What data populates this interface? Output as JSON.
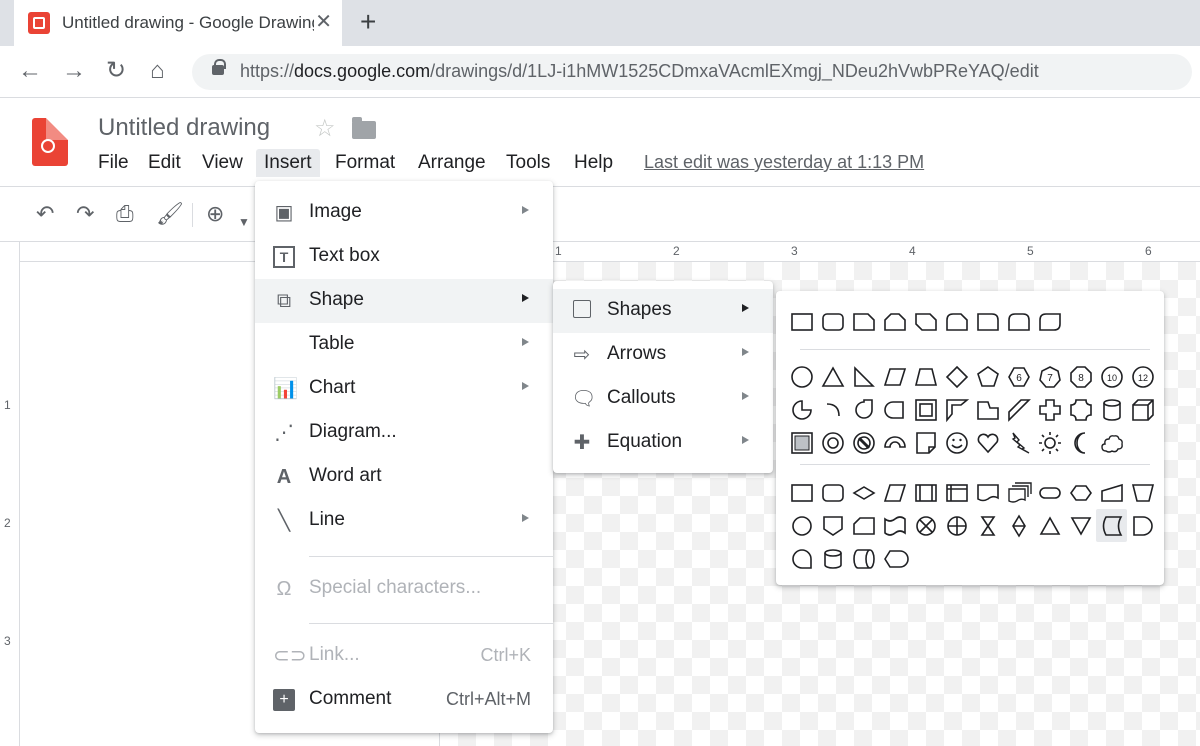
{
  "browser": {
    "tab_title": "Untitled drawing - Google Drawings",
    "tab_close": "✕",
    "new_tab": "+",
    "url_prefix": "https://",
    "url_domain": "docs.google.com",
    "url_path": "/drawings/d/1LJ-i1hMW1525CDmxaVAcmlEXmgj_NDeu2hVwbPReYAQ/edit"
  },
  "app": {
    "title": "Untitled drawing",
    "last_edit": "Last edit was yesterday at 1:13 PM",
    "menus": [
      "File",
      "Edit",
      "View",
      "Insert",
      "Format",
      "Arrange",
      "Tools",
      "Help"
    ],
    "active_menu": "Insert"
  },
  "ruler": {
    "top": [
      "1",
      "2",
      "3",
      "4",
      "5",
      "6"
    ],
    "left": [
      "1",
      "2",
      "3"
    ]
  },
  "insert_menu": {
    "items": [
      {
        "label": "Image",
        "icon": "image-icon"
      },
      {
        "label": "Text box",
        "icon": "text-box-icon"
      },
      {
        "label": "Shape",
        "icon": "shape-icon"
      },
      {
        "label": "Table",
        "icon": ""
      },
      {
        "label": "Chart",
        "icon": "chart-icon"
      },
      {
        "label": "Diagram...",
        "icon": "diagram-icon"
      },
      {
        "label": "Word art",
        "icon": "word-art-icon"
      },
      {
        "label": "Line",
        "icon": "line-icon"
      },
      {
        "label": "Special characters...",
        "icon": "omega-icon"
      },
      {
        "label": "Link...",
        "icon": "link-icon",
        "shortcut": "Ctrl+K"
      },
      {
        "label": "Comment",
        "icon": "comment-icon",
        "shortcut": "Ctrl+Alt+M"
      }
    ]
  },
  "shape_submenu": {
    "items": [
      {
        "label": "Shapes",
        "icon": "square-icon"
      },
      {
        "label": "Arrows",
        "icon": "arrow-icon"
      },
      {
        "label": "Callouts",
        "icon": "callout-icon"
      },
      {
        "label": "Equation",
        "icon": "plus-icon"
      }
    ]
  },
  "shapes_panel": {
    "octagon_numbers": [
      "6",
      "7",
      "8",
      "10",
      "12"
    ]
  }
}
